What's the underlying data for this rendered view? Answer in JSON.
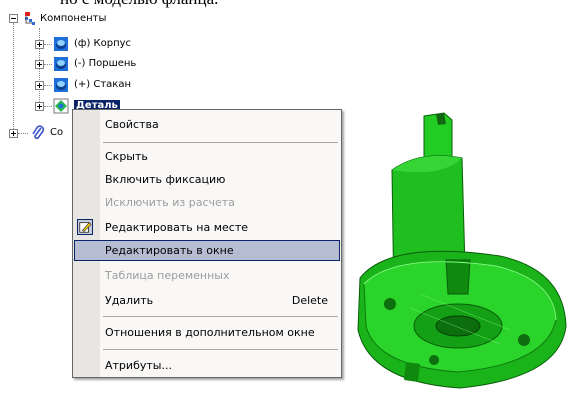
{
  "page": {
    "cut_text": "но с моделью фланца."
  },
  "tree": {
    "root_label": "Компоненты",
    "items": [
      {
        "label": "(ф) Корпус"
      },
      {
        "label": "(-) Поршень"
      },
      {
        "label": "(+) Стакан"
      },
      {
        "label": "Деталь"
      }
    ],
    "second_root_label": "Со"
  },
  "menu": {
    "items": [
      {
        "label": "Свойства",
        "shortcut": "",
        "state": "enabled"
      },
      {
        "label": "Скрыть",
        "shortcut": "",
        "state": "enabled"
      },
      {
        "label": "Включить фиксацию",
        "shortcut": "",
        "state": "enabled"
      },
      {
        "label": "Исключить из расчета",
        "shortcut": "",
        "state": "disabled"
      },
      {
        "label": "Редактировать на месте",
        "shortcut": "",
        "state": "enabled",
        "icon": "edit-in-place-icon"
      },
      {
        "label": "Редактировать в окне",
        "shortcut": "",
        "state": "highlighted"
      },
      {
        "label": "Таблица переменных",
        "shortcut": "",
        "state": "disabled"
      },
      {
        "label": "Удалить",
        "shortcut": "Delete",
        "state": "enabled"
      },
      {
        "label": "Отношения в дополнительном окне",
        "shortcut": "",
        "state": "enabled"
      },
      {
        "label": "Атрибуты...",
        "shortcut": "",
        "state": "enabled"
      }
    ]
  },
  "colors": {
    "selection": "#0a246a",
    "menu_highlight": "#b6bdd2",
    "model_green": "#22dd22",
    "component_icon_blue": "#1e6fd9"
  }
}
